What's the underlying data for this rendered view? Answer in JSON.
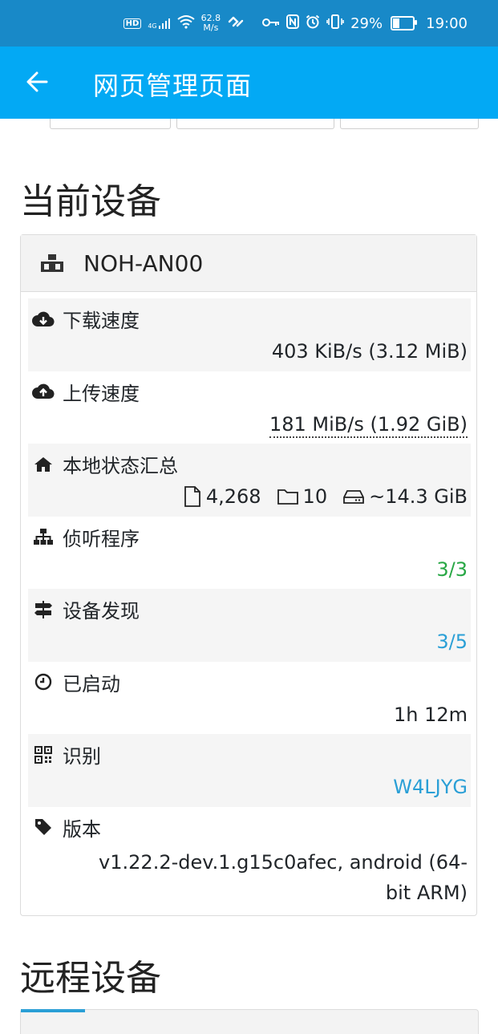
{
  "status_bar": {
    "network_hd": "HD",
    "network_gen": "4G",
    "speed_value": "62.8",
    "speed_unit": "M/s",
    "battery": "29%",
    "battery_level": 0.29,
    "time": "19:00"
  },
  "app_bar": {
    "title": "网页管理页面"
  },
  "sections": {
    "current_device": "当前设备",
    "remote_devices": "远程设备"
  },
  "device": {
    "name": "NOH-AN00",
    "rows": {
      "download": {
        "label": "下载速度",
        "value": "403 KiB/s (3.12 MiB)"
      },
      "upload": {
        "label": "上传速度",
        "value": "181 MiB/s (1.92 GiB)"
      },
      "local_state": {
        "label": "本地状态汇总",
        "files": "4,268",
        "folders": "10",
        "size": "~14.3 GiB"
      },
      "listeners": {
        "label": "侦听程序",
        "value": "3/3"
      },
      "discovery": {
        "label": "设备发现",
        "value": "3/5"
      },
      "uptime": {
        "label": "已启动",
        "value": "1h 12m"
      },
      "identification": {
        "label": "识别",
        "value": "W4LJYG"
      },
      "version": {
        "label": "版本",
        "value": "v1.22.2-dev.1.g15c0afec, android (64-bit ARM)"
      }
    }
  },
  "colors": {
    "status_bar": "#1889c8",
    "app_bar": "#03a9f4",
    "success": "#28a745",
    "info": "#2a9fd6"
  }
}
